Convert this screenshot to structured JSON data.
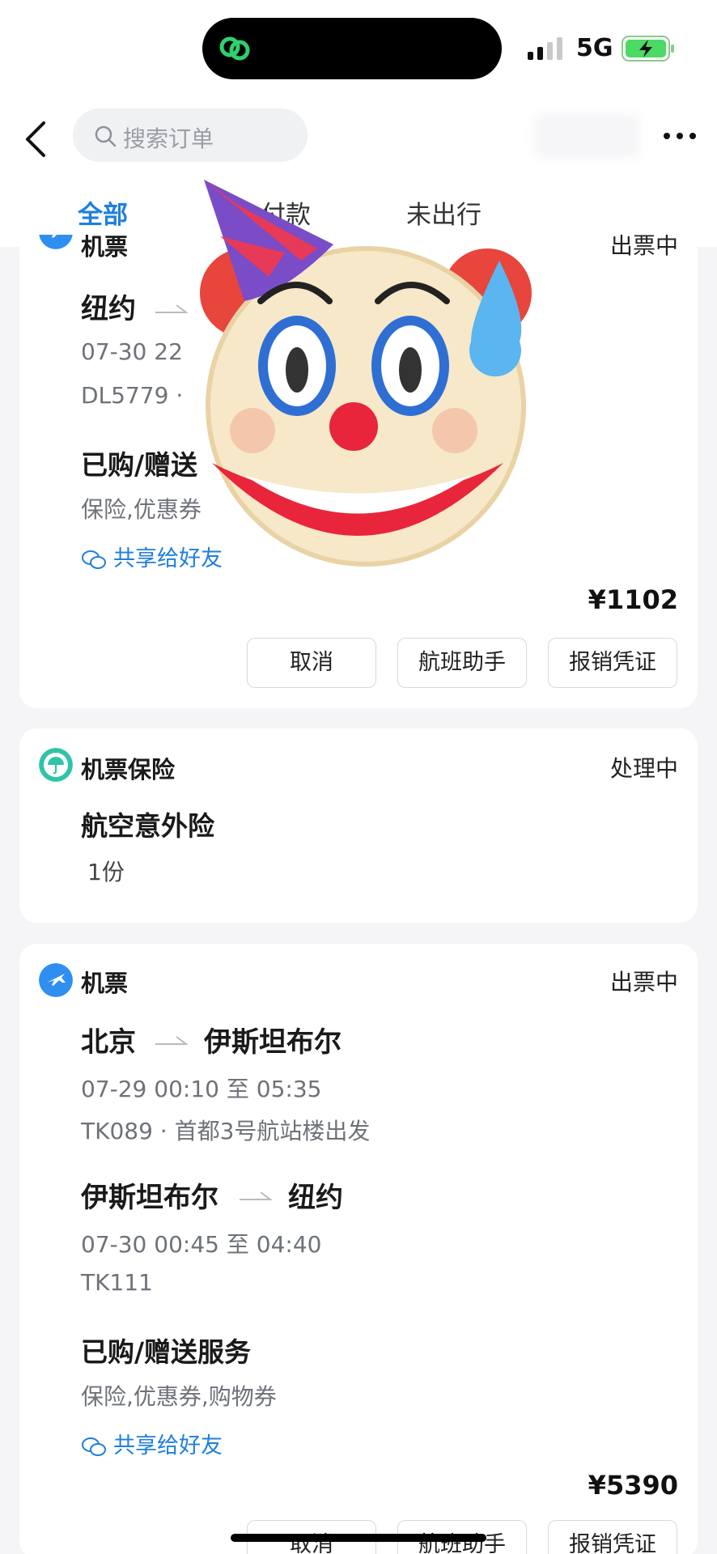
{
  "status_bar": {
    "network": "5G"
  },
  "header": {
    "search_placeholder": "搜索订单",
    "tabs": [
      {
        "label": "全部",
        "active": true
      },
      {
        "label": "付款",
        "active": false
      },
      {
        "label": "未出行",
        "active": false
      }
    ]
  },
  "orders": [
    {
      "type": "机票",
      "status": "出票中",
      "route": {
        "from": "纽约",
        "to": ""
      },
      "time": "07-30 22",
      "flight": "DL5779 ·",
      "services_title": "已购/赠送",
      "services": "保险,优惠券",
      "share_label": "共享给好友",
      "price": "¥1102",
      "buttons": [
        "取消",
        "航班助手",
        "报销凭证"
      ]
    },
    {
      "type": "机票保险",
      "status": "处理中",
      "product": "航空意外险",
      "quantity": "1份"
    },
    {
      "type": "机票",
      "status": "出票中",
      "legs": [
        {
          "from": "北京",
          "to": "伊斯坦布尔",
          "time": "07-29 00:10 至 05:35",
          "flight": "TK089 · 首都3号航站楼出发"
        },
        {
          "from": "伊斯坦布尔",
          "to": "纽约",
          "time": "07-30 00:45 至 04:40",
          "flight": "TK111"
        }
      ],
      "services_title": "已购/赠送服务",
      "services": "保险,优惠券,购物券",
      "share_label": "共享给好友",
      "price": "¥5390",
      "buttons": [
        "取消",
        "航班助手",
        "报销凭证"
      ]
    }
  ],
  "colors": {
    "accent": "#1e7fe0",
    "insurance": "#2fc4a8",
    "background": "#f5f5f7"
  }
}
